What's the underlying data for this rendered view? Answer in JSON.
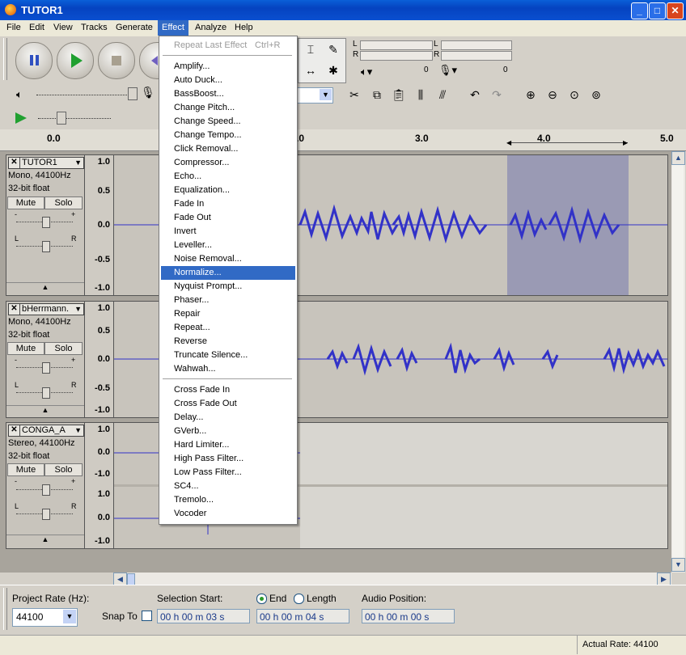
{
  "window": {
    "title": "TUTOR1"
  },
  "menubar": [
    "File",
    "Edit",
    "View",
    "Tracks",
    "Generate",
    "Effect",
    "Analyze",
    "Help"
  ],
  "active_menu": "Effect",
  "effect_menu": {
    "header": {
      "label": "Repeat Last Effect",
      "shortcut": "Ctrl+R"
    },
    "group1": [
      "Amplify...",
      "Auto Duck...",
      "BassBoost...",
      "Change Pitch...",
      "Change Speed...",
      "Change Tempo...",
      "Click Removal...",
      "Compressor...",
      "Echo...",
      "Equalization...",
      "Fade In",
      "Fade Out",
      "Invert",
      "Leveller...",
      "Noise Removal...",
      "Normalize...",
      "Nyquist Prompt...",
      "Phaser...",
      "Repair",
      "Repeat...",
      "Reverse",
      "Truncate Silence...",
      "Wahwah..."
    ],
    "group2": [
      "Cross Fade In",
      "Cross Fade Out",
      "Delay...",
      "GVerb...",
      "Hard Limiter...",
      "High Pass Filter...",
      "Low Pass Filter...",
      "SC4...",
      "Tremolo...",
      "Vocoder"
    ],
    "highlighted": "Normalize..."
  },
  "meters": {
    "left": "L",
    "right": "R",
    "zero1": "0",
    "zero2": "0"
  },
  "ruler": {
    "labels": [
      "0.0",
      ".0",
      "3.0",
      "4.0",
      "5.0"
    ]
  },
  "tracks": [
    {
      "name": "TUTOR1",
      "info1": "Mono, 44100Hz",
      "info2": "32-bit float",
      "mute": "Mute",
      "solo": "Solo",
      "scale": [
        "1.0",
        "0.5",
        "0.0",
        "-0.5",
        "-1.0"
      ]
    },
    {
      "name": "bHerrmann.",
      "info1": "Mono, 44100Hz",
      "info2": "32-bit float",
      "mute": "Mute",
      "solo": "Solo",
      "scale": [
        "1.0",
        "0.5",
        "0.0",
        "-0.5",
        "-1.0"
      ]
    },
    {
      "name": "CONGA_A",
      "info1": "Stereo, 44100Hz",
      "info2": "32-bit float",
      "mute": "Mute",
      "solo": "Solo",
      "scale": [
        "1.0",
        "0.0",
        "-1.0",
        "1.0",
        "0.0",
        "-1.0"
      ]
    }
  ],
  "gain_labels": {
    "minus": "-",
    "plus": "+",
    "l": "L",
    "r": "R"
  },
  "selection_bar": {
    "project_rate_label": "Project Rate (Hz):",
    "project_rate": "44100",
    "snap_to": "Snap To",
    "selection_start_label": "Selection Start:",
    "end_label": "End",
    "length_label": "Length",
    "audio_position_label": "Audio Position:",
    "start_time": "00 h 00 m 03 s",
    "end_time": "00 h 00 m 04 s",
    "audio_position": "00 h 00 m 00 s"
  },
  "status": {
    "actual_rate": "Actual Rate: 44100"
  },
  "colors": {
    "wave": "#3232c8",
    "selection": "#9a9ab4",
    "menu_highlight": "#316ac5"
  }
}
